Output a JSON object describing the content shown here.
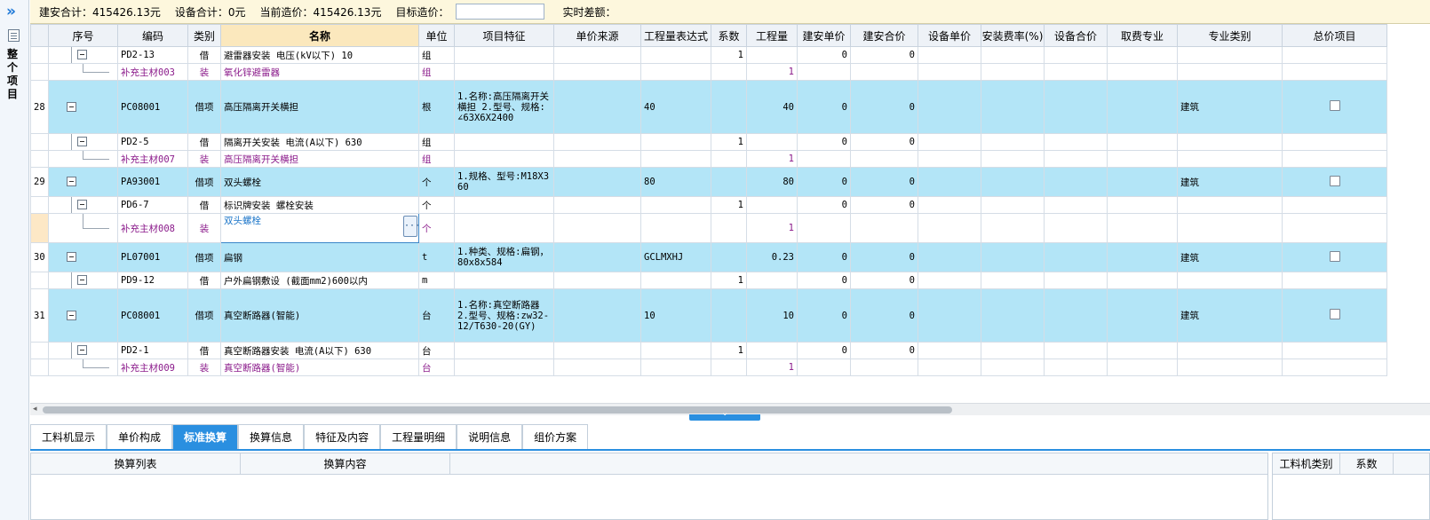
{
  "leftbar": {
    "label": "整个项目"
  },
  "summary": {
    "jian_an_total": "建安合计：415426.13元",
    "equip_total": "设备合计：0元",
    "current_cost": "当前造价：415426.13元",
    "target_cost_label": "目标造价：",
    "target_cost_value": "",
    "diff_label": "实时差额："
  },
  "columns": [
    "序号",
    "编码",
    "类别",
    "名称",
    "单位",
    "项目特征",
    "单价来源",
    "工程量表达式",
    "系数",
    "工程量",
    "建安单价",
    "建安合价",
    "设备单价",
    "安装费率(%)",
    "设备合价",
    "取费专业",
    "专业类别",
    "总价项目"
  ],
  "rows": [
    {
      "kind": "child",
      "seq": "",
      "code": "PD2-13",
      "cat": "借",
      "name": "避雷器安装 电压(kV以下) 10",
      "unit": "组",
      "feature": "",
      "src": "",
      "expr": "",
      "coef": "1",
      "qty": "",
      "jaup": "0",
      "jatot": "0",
      "eqp": "",
      "rate": "",
      "eqtot": "",
      "fee": "",
      "prof": "",
      "total": false
    },
    {
      "kind": "mat",
      "seq": "",
      "code": "补充主材003",
      "cat": "装",
      "name": "氧化锌避雷器",
      "unit": "组",
      "feature": "",
      "src": "",
      "expr": "",
      "coef": "",
      "qty": "1",
      "jaup": "",
      "jatot": "",
      "eqp": "",
      "rate": "",
      "eqtot": "",
      "fee": "",
      "prof": "",
      "total": false
    },
    {
      "kind": "parent",
      "seq": "28",
      "code": "PC08001",
      "cat": "借项",
      "name": "高压隔离开关横担",
      "unit": "根",
      "feature": "1.名称:高压隔离开关横担 2.型号、规格:∠63X6X2400",
      "src": "",
      "expr": "40",
      "coef": "",
      "qty": "40",
      "jaup": "0",
      "jatot": "0",
      "eqp": "",
      "rate": "",
      "eqtot": "",
      "fee": "",
      "prof": "建筑",
      "total": true
    },
    {
      "kind": "child",
      "seq": "",
      "code": "PD2-5",
      "cat": "借",
      "name": "隔离开关安装 电流(A以下) 630",
      "unit": "组",
      "feature": "",
      "src": "",
      "expr": "",
      "coef": "1",
      "qty": "",
      "jaup": "0",
      "jatot": "0",
      "eqp": "",
      "rate": "",
      "eqtot": "",
      "fee": "",
      "prof": "",
      "total": false
    },
    {
      "kind": "mat",
      "seq": "",
      "code": "补充主材007",
      "cat": "装",
      "name": "高压隔离开关横担",
      "unit": "组",
      "feature": "",
      "src": "",
      "expr": "",
      "coef": "",
      "qty": "1",
      "jaup": "",
      "jatot": "",
      "eqp": "",
      "rate": "",
      "eqtot": "",
      "fee": "",
      "prof": "",
      "total": false
    },
    {
      "kind": "parent",
      "seq": "29",
      "code": "PA93001",
      "cat": "借项",
      "name": "双头螺栓",
      "unit": "个",
      "feature": "1.规格、型号:M18X360",
      "src": "",
      "expr": "80",
      "coef": "",
      "qty": "80",
      "jaup": "0",
      "jatot": "0",
      "eqp": "",
      "rate": "",
      "eqtot": "",
      "fee": "",
      "prof": "建筑",
      "total": true
    },
    {
      "kind": "child",
      "seq": "",
      "code": "PD6-7",
      "cat": "借",
      "name": "标识牌安装 螺栓安装",
      "unit": "个",
      "feature": "",
      "src": "",
      "expr": "",
      "coef": "1",
      "qty": "",
      "jaup": "0",
      "jatot": "0",
      "eqp": "",
      "rate": "",
      "eqtot": "",
      "fee": "",
      "prof": "",
      "total": false
    },
    {
      "kind": "mat-selected",
      "seq": "",
      "code": "补充主材008",
      "cat": "装",
      "name": "双头螺栓",
      "unit": "个",
      "feature": "",
      "src": "",
      "expr": "",
      "coef": "",
      "qty": "1",
      "jaup": "",
      "jatot": "",
      "eqp": "",
      "rate": "",
      "eqtot": "",
      "fee": "",
      "prof": "",
      "total": false
    },
    {
      "kind": "parent",
      "seq": "30",
      "code": "PL07001",
      "cat": "借项",
      "name": "扁钢",
      "unit": "t",
      "feature": "1.种类、规格:扁钢，80x8x584",
      "src": "",
      "expr": "GCLMXHJ",
      "coef": "",
      "qty": "0.23",
      "jaup": "0",
      "jatot": "0",
      "eqp": "",
      "rate": "",
      "eqtot": "",
      "fee": "",
      "prof": "建筑",
      "total": true
    },
    {
      "kind": "child",
      "seq": "",
      "code": "PD9-12",
      "cat": "借",
      "name": "户外扁钢敷设 (截面mm2)600以内",
      "unit": "m",
      "feature": "",
      "src": "",
      "expr": "",
      "coef": "1",
      "qty": "",
      "jaup": "0",
      "jatot": "0",
      "eqp": "",
      "rate": "",
      "eqtot": "",
      "fee": "",
      "prof": "",
      "total": false
    },
    {
      "kind": "parent",
      "seq": "31",
      "code": "PC08001",
      "cat": "借项",
      "name": "真空断路器(智能)",
      "unit": "台",
      "feature": "1.名称:真空断路器 2.型号、规格:zw32-12/T630-20(GY)",
      "src": "",
      "expr": "10",
      "coef": "",
      "qty": "10",
      "jaup": "0",
      "jatot": "0",
      "eqp": "",
      "rate": "",
      "eqtot": "",
      "fee": "",
      "prof": "建筑",
      "total": true
    },
    {
      "kind": "child",
      "seq": "",
      "code": "PD2-1",
      "cat": "借",
      "name": "真空断路器安装 电流(A以下) 630",
      "unit": "台",
      "feature": "",
      "src": "",
      "expr": "",
      "coef": "1",
      "qty": "",
      "jaup": "0",
      "jatot": "0",
      "eqp": "",
      "rate": "",
      "eqtot": "",
      "fee": "",
      "prof": "",
      "total": false
    },
    {
      "kind": "mat",
      "seq": "",
      "code": "补充主材009",
      "cat": "装",
      "name": "真空断路器(智能)",
      "unit": "台",
      "feature": "",
      "src": "",
      "expr": "",
      "coef": "",
      "qty": "1",
      "jaup": "",
      "jatot": "",
      "eqp": "",
      "rate": "",
      "eqtot": "",
      "fee": "",
      "prof": "",
      "total": false
    }
  ],
  "tabs": [
    "工料机显示",
    "单价构成",
    "标准换算",
    "换算信息",
    "特征及内容",
    "工程量明细",
    "说明信息",
    "组价方案"
  ],
  "active_tab": "标准换算",
  "bottom_left_headers": [
    "换算列表",
    "换算内容"
  ],
  "bottom_right_headers": [
    "工料机类别",
    "系数"
  ]
}
